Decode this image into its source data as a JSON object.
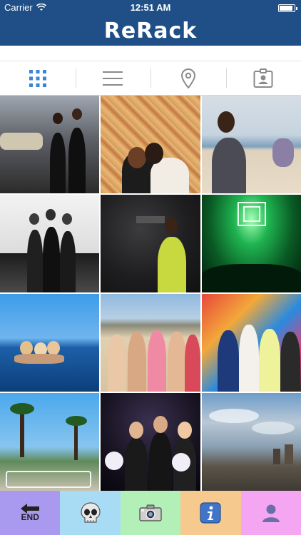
{
  "status_bar": {
    "carrier": "Carrier",
    "time": "12:51 AM",
    "battery_level": 0.9
  },
  "header": {
    "title": "ReRack"
  },
  "search": {
    "placeholder": ""
  },
  "tabs": [
    {
      "icon": "grid-icon",
      "active": true
    },
    {
      "icon": "list-icon",
      "active": false
    },
    {
      "icon": "location-pin-icon",
      "active": false
    },
    {
      "icon": "contact-badge-icon",
      "active": false
    }
  ],
  "photos": [
    {
      "scene": "night street group"
    },
    {
      "scene": "two girls floral wall"
    },
    {
      "scene": "girl on beach"
    },
    {
      "scene": "three girls black and white"
    },
    {
      "scene": "girl in yellow dress dark room"
    },
    {
      "scene": "green concert lights"
    },
    {
      "scene": "infinity pool ocean"
    },
    {
      "scene": "bikini group on beach"
    },
    {
      "scene": "girls in colorful bar"
    },
    {
      "scene": "cabo sign palm trees"
    },
    {
      "scene": "girls with cotton candy"
    },
    {
      "scene": "city skyline clouds"
    }
  ],
  "toolbar": {
    "end_label": "END",
    "colors": [
      "#a99af0",
      "#a8dcf5",
      "#b3f0b8",
      "#f6c98f",
      "#f4a6f2"
    ],
    "icons": [
      "back-arrow-icon",
      "skull-icon",
      "camera-icon",
      "info-icon",
      "profile-icon"
    ]
  }
}
